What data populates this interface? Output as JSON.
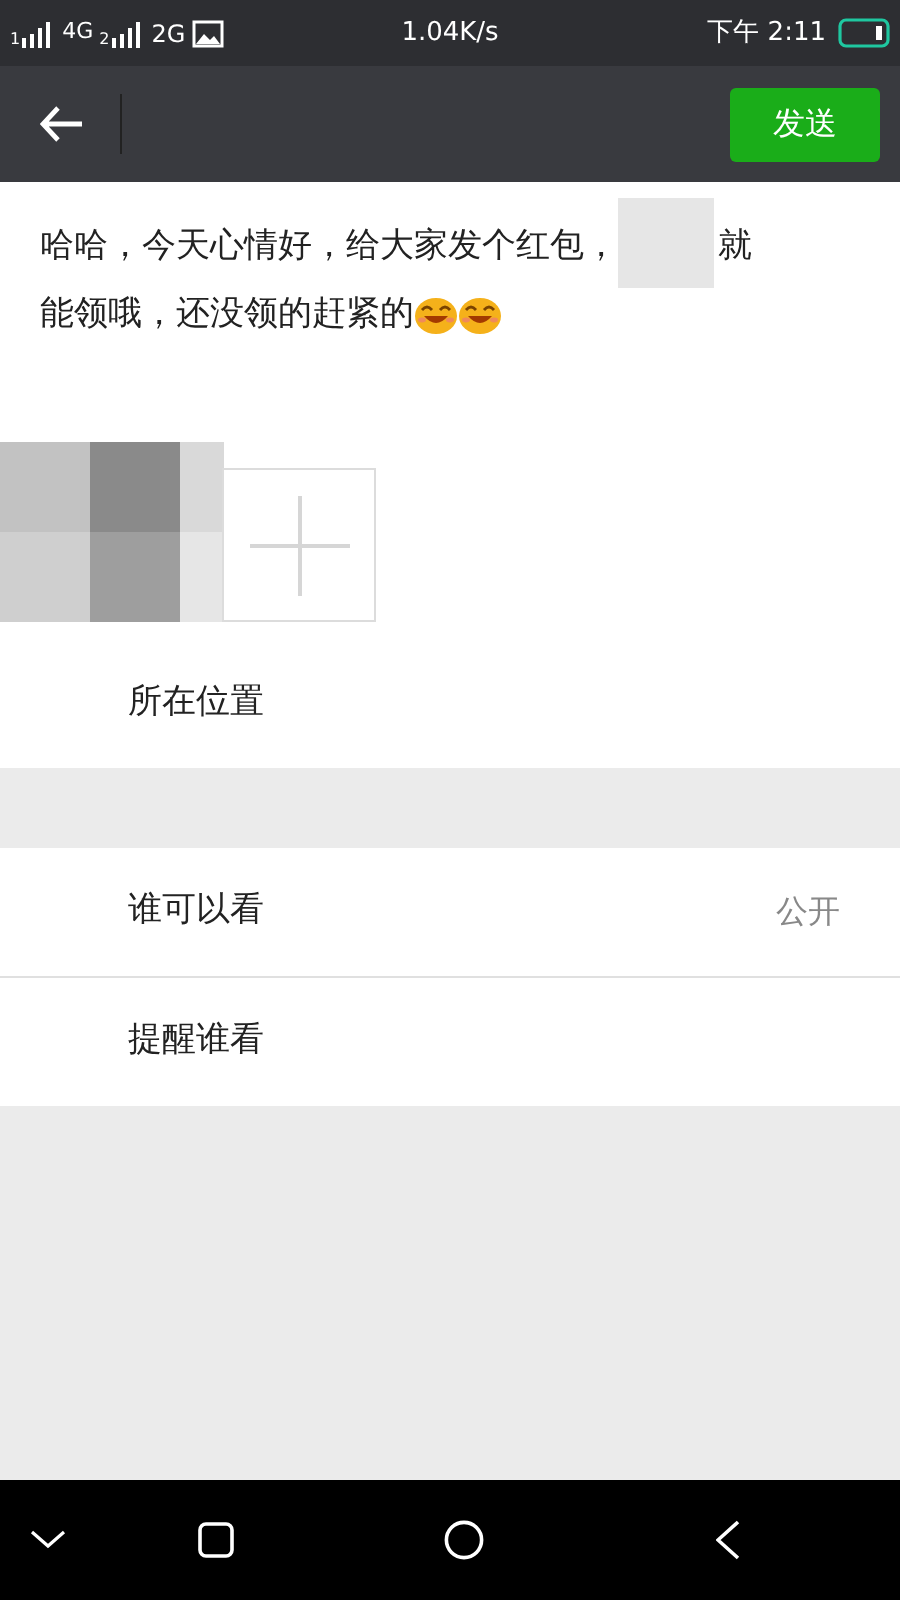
{
  "status_bar": {
    "sim1_slot": "1",
    "sim2_slot": "2",
    "sim1_network": "4G",
    "sim2_network": "2G",
    "speed": "1.04K/s",
    "time": "下午 2:11"
  },
  "toolbar": {
    "send_button": "发送"
  },
  "post": {
    "line_1": "哈哈，今天心情好，给大家发个红包，",
    "line_1_end": "就",
    "line_2": "能领哦，还没领的赶紧的"
  },
  "photos": [
    {
      "kind": "picture"
    },
    {
      "kind": "add"
    }
  ],
  "settings_groups": [
    [
      {
        "label": "所在位置"
      }
    ],
    [
      {
        "label": "谁可以看",
        "value": "公开"
      },
      {
        "label": "提醒谁看"
      }
    ]
  ]
}
